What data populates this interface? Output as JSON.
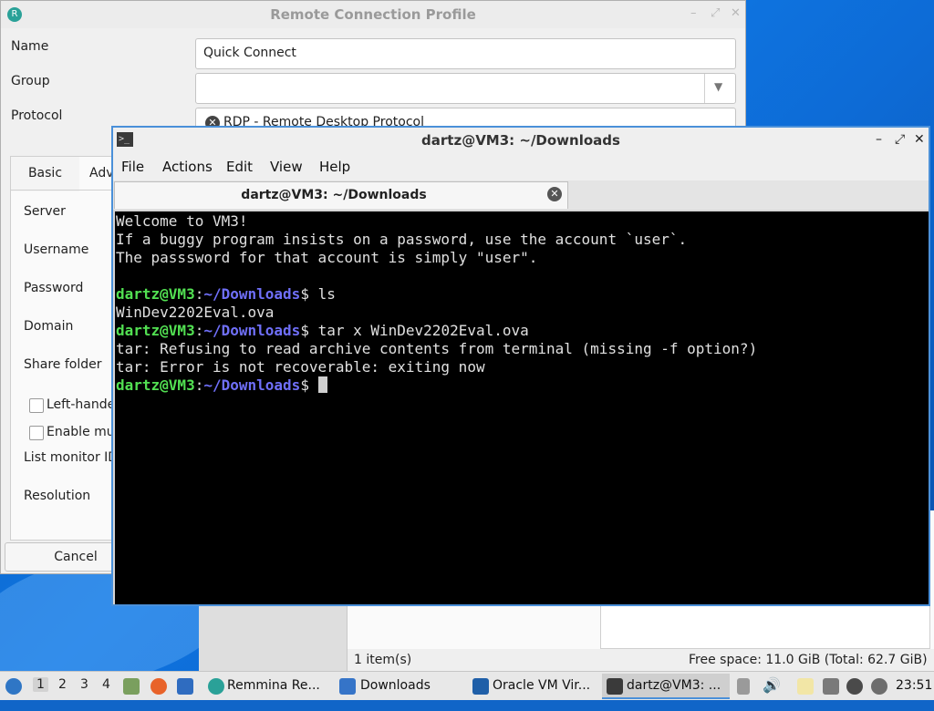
{
  "remmina": {
    "title": "Remote Connection Profile",
    "labels": {
      "name": "Name",
      "group": "Group",
      "protocol": "Protocol"
    },
    "name_value": "Quick Connect",
    "group_value": "",
    "protocol_value": "RDP - Remote Desktop Protocol",
    "tabs": {
      "basic": "Basic",
      "advanced": "Adv"
    },
    "fields": {
      "server": "Server",
      "username": "Username",
      "password": "Password",
      "domain": "Domain",
      "share_folder": "Share folder",
      "left_handed": "Left-hande",
      "enable_multi": "Enable mul",
      "list_monitor": "List monitor ID",
      "resolution": "Resolution"
    },
    "cancel_label": "Cancel"
  },
  "terminal": {
    "title": "dartz@VM3: ~/Downloads",
    "menu": [
      "File",
      "Actions",
      "Edit",
      "View",
      "Help"
    ],
    "tab_title": "dartz@VM3: ~/Downloads",
    "lines": [
      "Welcome to VM3!",
      "If a buggy program insists on a password, use the account `user`.",
      "The passsword for that account is simply \"user\"."
    ],
    "prompt_user": "dartz@VM3",
    "prompt_sep": ":",
    "prompt_path": "~/Downloads",
    "prompt_end": "$ ",
    "cmd1": "ls",
    "out1": "WinDev2202Eval.ova",
    "cmd2": "tar x WinDev2202Eval.ova",
    "out2": "tar: Refusing to read archive contents from terminal (missing -f option?)",
    "out3": "tar: Error is not recoverable: exiting now"
  },
  "file_manager": {
    "item_count": "1 item(s)",
    "free_space": "Free space: 11.0 GiB (Total: 62.7 GiB)"
  },
  "taskbar": {
    "workspaces": [
      "1",
      "2",
      "3",
      "4"
    ],
    "tasks": {
      "remmina": "Remmina Re...",
      "downloads": "Downloads",
      "oracle": "Oracle VM Vir...",
      "terminal": "dartz@VM3: ..."
    },
    "clock": "23:51"
  }
}
